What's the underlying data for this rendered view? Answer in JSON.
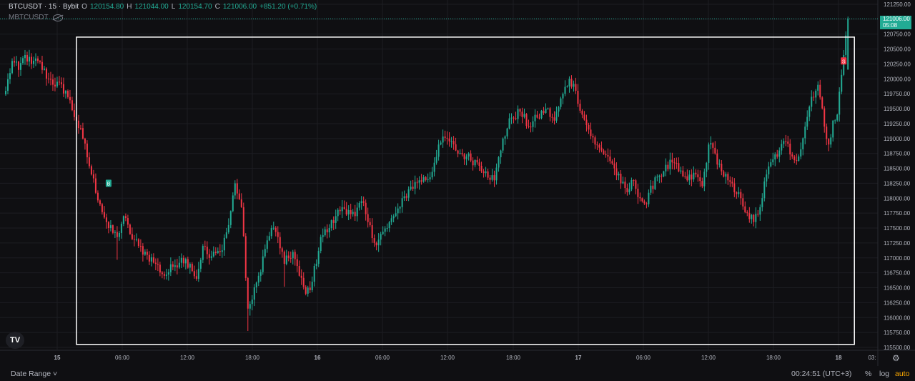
{
  "legend": {
    "symbol": "BTCUSDT · 15 · Bybit",
    "open_key": "O",
    "open": "120154.80",
    "high_key": "H",
    "high": "121044.00",
    "low_key": "L",
    "low": "120154.70",
    "close_key": "C",
    "close": "121006.00",
    "change": "+851.20 (+0.71%)"
  },
  "indicator": {
    "name": "MBTCUSDT"
  },
  "logo": {
    "text": "TV"
  },
  "last_price": {
    "value": "121006.00",
    "countdown": "05:08"
  },
  "bottom_bar": {
    "date_range": "Date Range ˅",
    "clock": "00:24:51 (UTC+3)",
    "percent": "%",
    "log": "log",
    "auto": "auto"
  },
  "markers": {
    "buy": "B",
    "sell": "S"
  },
  "colors": {
    "up": "#22ab94",
    "down": "#f23645",
    "box": "#ffffff",
    "auto": "#f7a600"
  },
  "chart_data": {
    "type": "candlestick",
    "symbol": "BTCUSDT",
    "interval": "15",
    "exchange": "Bybit",
    "ylim": [
      115500,
      122250
    ],
    "y_ticks": [
      115500,
      115750,
      116000,
      116250,
      116500,
      116750,
      117000,
      117250,
      117500,
      117750,
      118000,
      118250,
      118500,
      118750,
      119000,
      119250,
      119500,
      119750,
      120000,
      120250,
      120500,
      120750,
      121000,
      121250
    ],
    "x_ticks": [
      "15",
      "06:00",
      "12:00",
      "18:00",
      "16",
      "06:00",
      "12:00",
      "18:00",
      "17",
      "06:00",
      "12:00",
      "18:00",
      "18",
      "03:"
    ],
    "x_tick_bold": [
      true,
      false,
      false,
      false,
      true,
      false,
      false,
      false,
      true,
      false,
      false,
      false,
      true,
      false
    ],
    "anchors": [
      [
        0,
        119800
      ],
      [
        3,
        120300
      ],
      [
        6,
        120150
      ],
      [
        9,
        120400
      ],
      [
        12,
        120250
      ],
      [
        15,
        120300
      ],
      [
        20,
        120000
      ],
      [
        28,
        119800
      ],
      [
        33,
        119300
      ],
      [
        36,
        119000
      ],
      [
        40,
        118400
      ],
      [
        44,
        117900
      ],
      [
        48,
        117500
      ],
      [
        52,
        117350
      ],
      [
        55,
        117700
      ],
      [
        58,
        117400
      ],
      [
        62,
        117200
      ],
      [
        66,
        117050
      ],
      [
        70,
        116900
      ],
      [
        74,
        116700
      ],
      [
        78,
        116850
      ],
      [
        82,
        117000
      ],
      [
        86,
        116900
      ],
      [
        89,
        116650
      ],
      [
        92,
        117200
      ],
      [
        95,
        117000
      ],
      [
        100,
        117100
      ],
      [
        104,
        117550
      ],
      [
        107,
        118250
      ],
      [
        110,
        117850
      ],
      [
        113,
        116150
      ],
      [
        115,
        116300
      ],
      [
        118,
        116700
      ],
      [
        121,
        117150
      ],
      [
        124,
        117500
      ],
      [
        127,
        117350
      ],
      [
        130,
        116900
      ],
      [
        134,
        117100
      ],
      [
        137,
        116700
      ],
      [
        140,
        116400
      ],
      [
        143,
        116600
      ],
      [
        147,
        117350
      ],
      [
        151,
        117500
      ],
      [
        154,
        117700
      ],
      [
        157,
        117850
      ],
      [
        160,
        117800
      ],
      [
        163,
        117700
      ],
      [
        166,
        117950
      ],
      [
        169,
        117600
      ],
      [
        172,
        117250
      ],
      [
        175,
        117400
      ],
      [
        178,
        117500
      ],
      [
        181,
        117700
      ],
      [
        184,
        117850
      ],
      [
        188,
        118150
      ],
      [
        193,
        118300
      ],
      [
        198,
        118350
      ],
      [
        202,
        118900
      ],
      [
        206,
        119000
      ],
      [
        210,
        118800
      ],
      [
        215,
        118700
      ],
      [
        220,
        118600
      ],
      [
        224,
        118450
      ],
      [
        228,
        118300
      ],
      [
        232,
        119000
      ],
      [
        236,
        119350
      ],
      [
        240,
        119450
      ],
      [
        244,
        119200
      ],
      [
        248,
        119350
      ],
      [
        252,
        119500
      ],
      [
        256,
        119300
      ],
      [
        260,
        119750
      ],
      [
        263,
        120000
      ],
      [
        266,
        119800
      ],
      [
        269,
        119400
      ],
      [
        272,
        119150
      ],
      [
        275,
        118900
      ],
      [
        278,
        118800
      ],
      [
        281,
        118700
      ],
      [
        284,
        118500
      ],
      [
        287,
        118250
      ],
      [
        290,
        118100
      ],
      [
        293,
        118300
      ],
      [
        296,
        118000
      ],
      [
        299,
        117900
      ],
      [
        303,
        118350
      ],
      [
        307,
        118450
      ],
      [
        311,
        118600
      ],
      [
        314,
        118450
      ],
      [
        318,
        118300
      ],
      [
        322,
        118400
      ],
      [
        325,
        118200
      ],
      [
        328,
        118900
      ],
      [
        331,
        118750
      ],
      [
        334,
        118450
      ],
      [
        337,
        118300
      ],
      [
        340,
        118100
      ],
      [
        343,
        118000
      ],
      [
        346,
        117750
      ],
      [
        349,
        117600
      ],
      [
        352,
        117850
      ],
      [
        355,
        118400
      ],
      [
        358,
        118650
      ],
      [
        361,
        118800
      ],
      [
        364,
        118950
      ],
      [
        367,
        118700
      ],
      [
        370,
        118700
      ],
      [
        373,
        119200
      ],
      [
        376,
        119700
      ],
      [
        379,
        119900
      ],
      [
        382,
        119200
      ],
      [
        384,
        118900
      ],
      [
        386,
        119300
      ],
      [
        388,
        119400
      ],
      [
        391,
        120400
      ],
      [
        393,
        121006
      ]
    ],
    "last": {
      "open": 120154.8,
      "high": 121044.0,
      "low": 120154.7,
      "close": 121006.0,
      "change": 851.2,
      "change_pct": 0.71
    },
    "buy_marker": {
      "bar": 48,
      "price": 118250
    },
    "sell_marker": {
      "bar": 391,
      "price": 120300
    },
    "selection_box": {
      "from_bar": 33,
      "to_bar": 396,
      "price_low": 115550,
      "price_high": 120700
    },
    "grid": true
  }
}
